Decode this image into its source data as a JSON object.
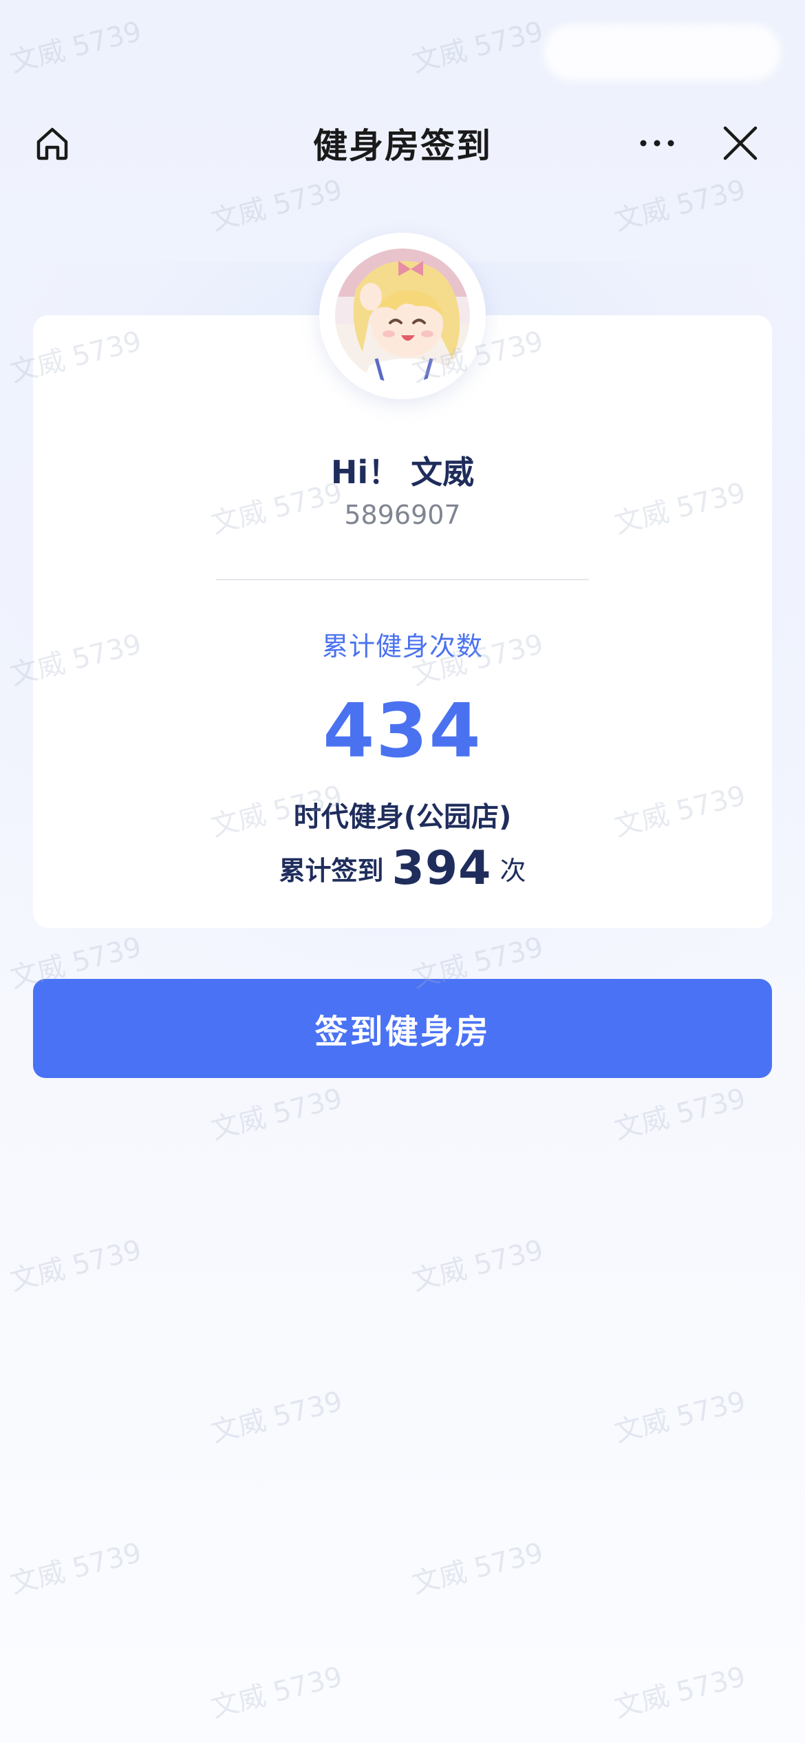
{
  "nav": {
    "title": "健身房签到",
    "home_icon": "home-icon",
    "more_icon": "more-dots-icon",
    "close_icon": "close-icon"
  },
  "profile": {
    "greeting": "Hi！ 文威",
    "member_id": "5896907",
    "avatar": "anime-avatar"
  },
  "stats": {
    "label": "累计健身次数",
    "total_workouts": "434",
    "gym_name": "时代健身(公园店)",
    "checkin_prefix": "累计签到",
    "checkin_count": "394",
    "checkin_unit": "次"
  },
  "action": {
    "checkin_button_label": "签到健身房"
  },
  "watermark": {
    "text": "文威 5739"
  },
  "colors": {
    "accent": "#4a72f5",
    "title_text": "#1f2d5c",
    "muted_text": "#808592"
  }
}
